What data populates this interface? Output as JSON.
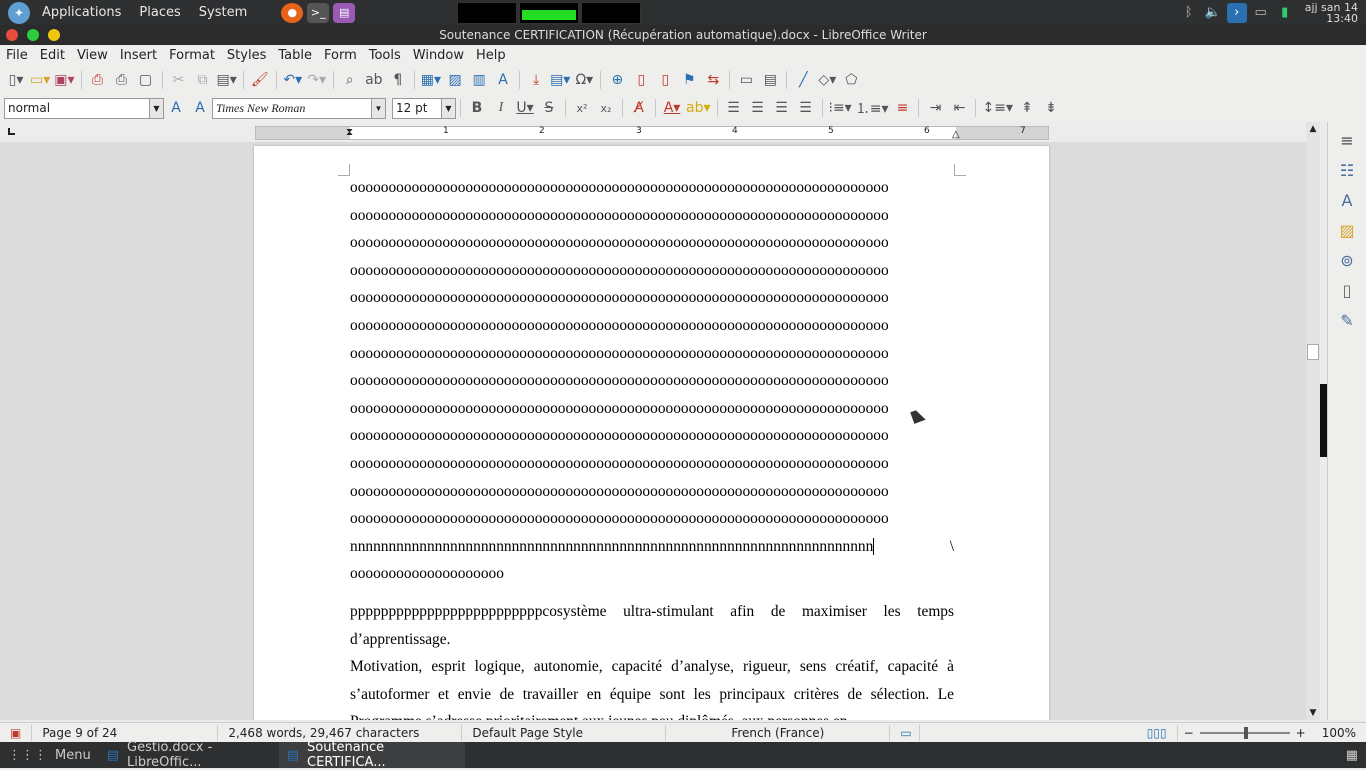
{
  "topbar": {
    "menus": [
      "Applications",
      "Places",
      "System"
    ],
    "clock_line1": "ajj san 14",
    "clock_line2": "13:40"
  },
  "window": {
    "title": "Soutenance CERTIFICATION (Récupération automatique).docx - LibreOffice Writer"
  },
  "menubar": [
    "File",
    "Edit",
    "View",
    "Insert",
    "Format",
    "Styles",
    "Table",
    "Form",
    "Tools",
    "Window",
    "Help"
  ],
  "format": {
    "paragraph_style": "normal",
    "font_name": "Times New Roman",
    "font_size": "12 pt"
  },
  "ruler": {
    "numbers": [
      "1",
      "1",
      "2",
      "3",
      "4",
      "5",
      "6",
      "7"
    ]
  },
  "document": {
    "lines": [
      "oooooooooooooooooooooooooooooooooooooooooooooooooooooooooooooooooooooo",
      "oooooooooooooooooooooooooooooooooooooooooooooooooooooooooooooooooooooo",
      "oooooooooooooooooooooooooooooooooooooooooooooooooooooooooooooooooooooo",
      "oooooooooooooooooooooooooooooooooooooooooooooooooooooooooooooooooooooo",
      "oooooooooooooooooooooooooooooooooooooooooooooooooooooooooooooooooooooo",
      "oooooooooooooooooooooooooooooooooooooooooooooooooooooooooooooooooooooo",
      "oooooooooooooooooooooooooooooooooooooooooooooooooooooooooooooooooooooo",
      "oooooooooooooooooooooooooooooooooooooooooooooooooooooooooooooooooooooo",
      "oooooooooooooooooooooooooooooooooooooooooooooooooooooooooooooooooooooo",
      "oooooooooooooooooooooooooooooooooooooooooooooooooooooooooooooooooooooo",
      "oooooooooooooooooooooooooooooooooooooooooooooooooooooooooooooooooooooo",
      "oooooooooooooooooooooooooooooooooooooooooooooooooooooooooooooooooooooo",
      "oooooooooooooooooooooooooooooooooooooooooooooooooooooooooooooooooooooo"
    ],
    "n_line": "nnnnnnnnnnnnnnnnnnnnnnnnnnnnnnnnnnnnnnnnnnnnnnnnnnnnnnnnnnnnnnnnnnnn",
    "n_line_tail": "\\",
    "o_short": "oooooooooooooooooooo",
    "para1": "pppppppppppppppppppppppppcosystème ultra-stimulant afin de maximiser les temps d’apprentissage.",
    "para2": "Motivation, esprit logique, autonomie, capacité d’analyse, rigueur, sens créatif, capacité à s’autoformer et envie de travailler en équipe sont les principaux critères de sélection. Le Programme s’adresse prioritairement aux jeunes peu diplômés, aux personnes en"
  },
  "statusbar": {
    "page": "Page 9 of 24",
    "words": "2,468 words, 29,467 characters",
    "page_style": "Default Page Style",
    "language": "French (France)",
    "zoom": "100%"
  },
  "taskbar": {
    "menu": "Menu",
    "tasks": [
      "Gestio.docx - LibreOffic...",
      "Soutenance CERTIFICA..."
    ]
  }
}
